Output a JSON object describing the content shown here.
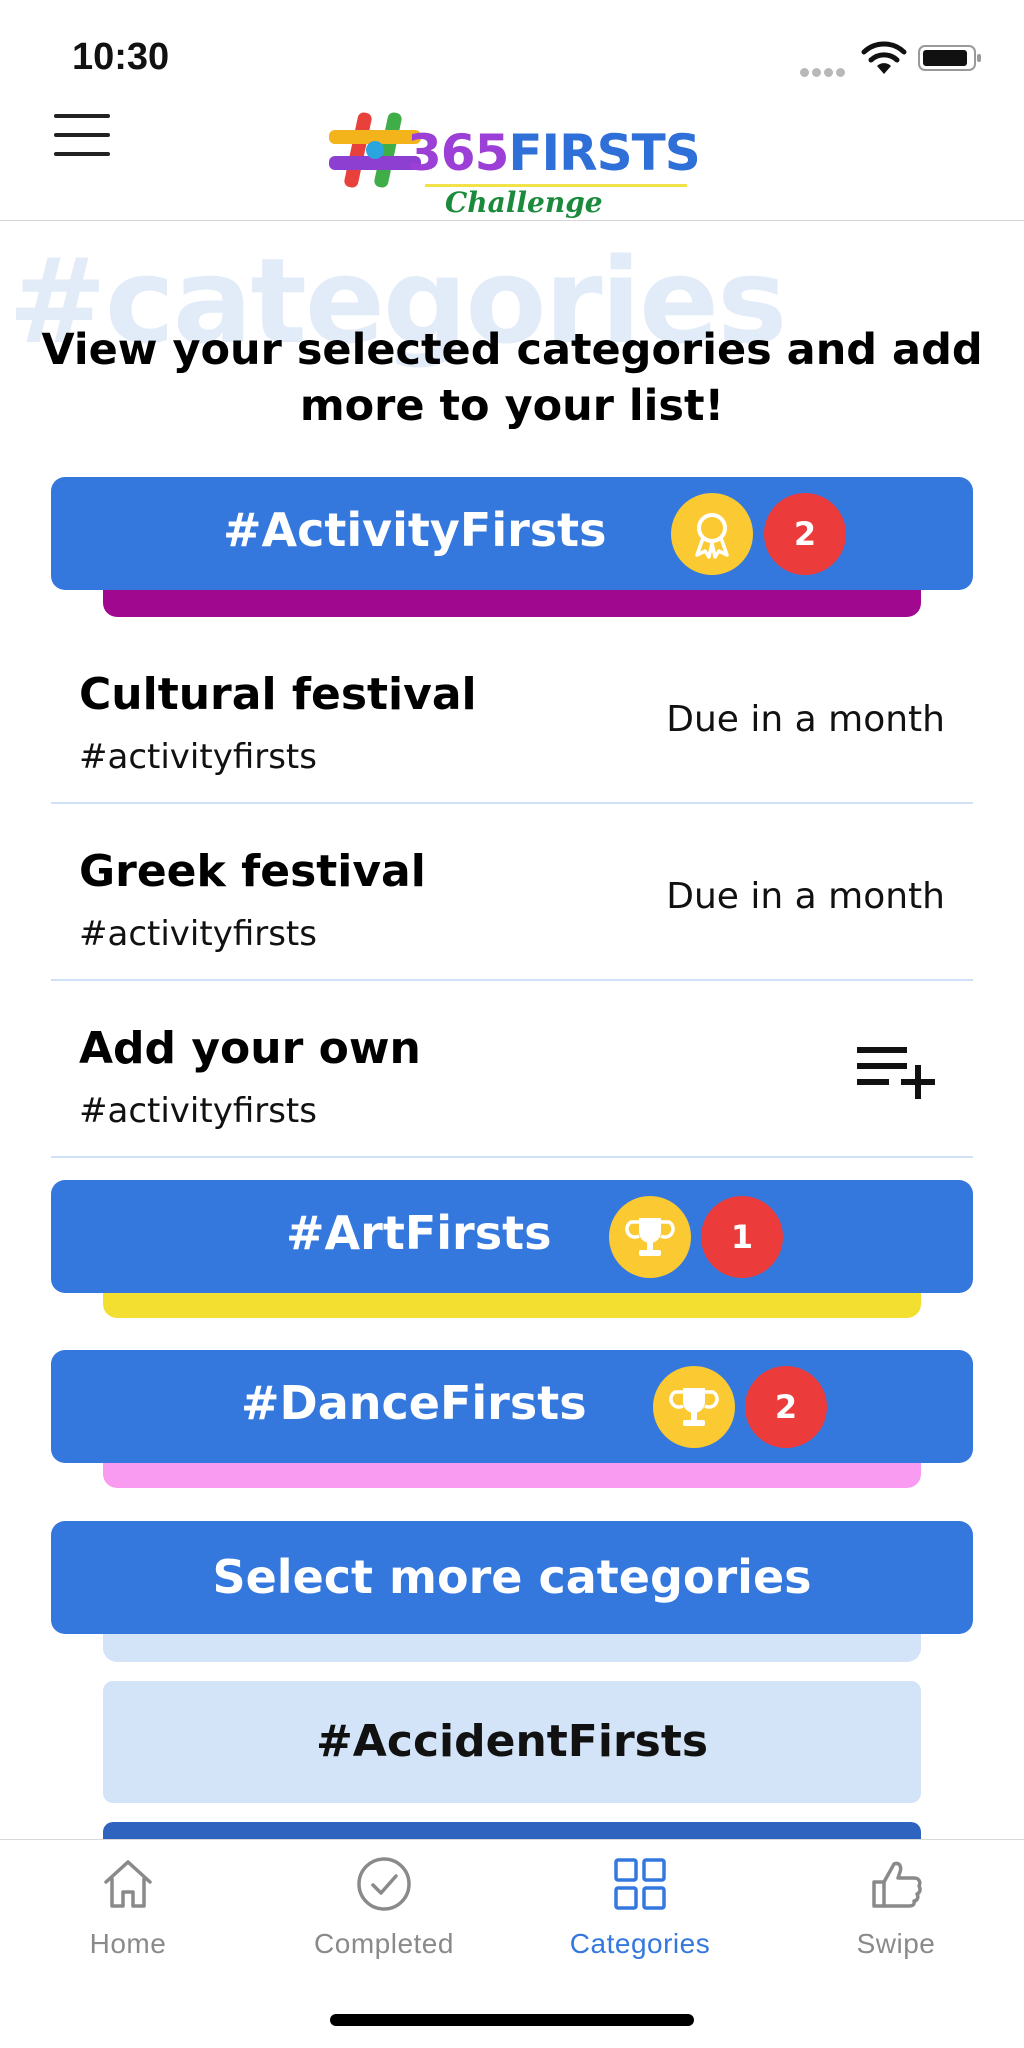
{
  "status_bar": {
    "time": "10:30"
  },
  "header": {
    "logo": {
      "hash": "#",
      "number": "365",
      "word": "FIRSTS",
      "subtitle": "Challenge"
    }
  },
  "page": {
    "watermark": "#categories",
    "subtitle": "View your selected categories and add more to your list!"
  },
  "categories": [
    {
      "title": "#ActivityFirsts",
      "badge_icon": "ribbon-medal-icon",
      "count": "2",
      "tab_color": "#a0088f"
    },
    {
      "title": "#ArtFirsts",
      "badge_icon": "trophy-icon",
      "count": "1",
      "tab_color": "#f3df30"
    },
    {
      "title": "#DanceFirsts",
      "badge_icon": "trophy-icon",
      "count": "2",
      "tab_color": "#f99bf0"
    }
  ],
  "activity_items": [
    {
      "title": "Cultural festival",
      "tag": "#activityfirsts",
      "due": "Due in a month"
    },
    {
      "title": "Greek festival",
      "tag": "#activityfirsts",
      "due": "Due in a month"
    },
    {
      "title": "Add your own",
      "tag": "#activityfirsts",
      "icon": "playlist-add-icon"
    }
  ],
  "select_more": {
    "label": "Select more categories"
  },
  "unselected": [
    {
      "title": "#AccidentFirsts"
    }
  ],
  "tab_bar": {
    "items": [
      {
        "label": "Home",
        "icon": "home-icon",
        "active": false
      },
      {
        "label": "Completed",
        "icon": "check-circle-icon",
        "active": false
      },
      {
        "label": "Categories",
        "icon": "grid-icon",
        "active": true
      },
      {
        "label": "Swipe",
        "icon": "thumbs-up-icon",
        "active": false
      }
    ]
  },
  "colors": {
    "primary_blue": "#3478de",
    "badge_red": "#ec3b3b",
    "medal_yellow": "#fbc931",
    "light_blue": "#d3e3f8",
    "tab_inactive": "#8a8a8a"
  }
}
